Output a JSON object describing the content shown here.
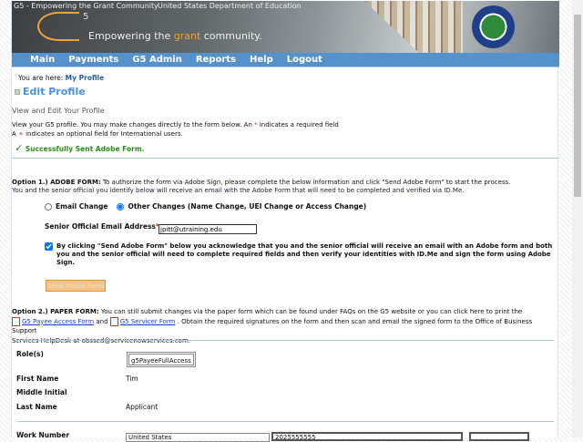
{
  "header": {
    "logo_alt": "G5 - Empowering the Grant Community",
    "dept_alt": "United States Department of Education",
    "logo_number": "5",
    "tagline_pre": "Empowering the ",
    "tagline_accent": "grant",
    "tagline_post": " community."
  },
  "nav": [
    {
      "label": "Main"
    },
    {
      "label": "Payments"
    },
    {
      "label": "G5 Admin"
    },
    {
      "label": "Reports"
    },
    {
      "label": "Help"
    },
    {
      "label": "Logout"
    }
  ],
  "breadcrumb": {
    "prefix": "You are here:",
    "current": "My Profile"
  },
  "page_title": "Edit Profile",
  "subtitle": "View and Edit Your Profile",
  "intro": {
    "line1_pre": "View your G5 profile. You may make changes directly to the form below. An ",
    "line1_mark": "*",
    "line1_post": " indicates a required field",
    "line2_pre": "A ",
    "line2_mark": "+",
    "line2_post": " indicates an optional field for International users."
  },
  "success_message": "Successfully Sent Adobe Form.",
  "option1": {
    "label": "Option 1.) ADOBE FORM:",
    "text": " To authorize the form via Adobe Sign, please complete the below information and click \"Send Adobe Form\" to start the process.",
    "text2": "You and the senior official you identify below will receive an email with the Adobe Form that will need to be completed and verified via ID.Me.",
    "radio_email": "Email Change",
    "radio_other": "Other Changes (Name Change, UEI Change or Access Change)",
    "selected": "Other Changes",
    "email_label": "Senior Official Email Address",
    "email_required": "*",
    "email_value": "jpitt@utraining.edu",
    "ack_checked": true,
    "ack_text": "By clicking \"Send Adobe Form\" below you acknowledge that you and the senior official will receive an email with an Adobe form and both you and the senior official will need to complete required fields and then verify your identities with ID.Me and sign the form using Adobe Sign.",
    "send_button": "Send Adobe Form"
  },
  "option2": {
    "label": "Option 2.) PAPER FORM:",
    "text": " You can still submit changes via the paper form which can be found under FAQs on the G5 website or you can click here to print the",
    "link1": "G5 Payee Access Form",
    "and": "and",
    "link2": "G5 Servicer Form",
    "text2": ". Obtain the required signatures on the form and then scan and email the signed form to the Office of Business Support",
    "text3": "Services HelpDesk at obssed@servicenowservices.com."
  },
  "profile": {
    "roles_label": "Role(s)",
    "roles_value": "g5PayeeFullAccess",
    "first_name_label": "First Name",
    "first_name": "Tim",
    "middle_label": "Middle Initial",
    "middle": "",
    "last_name_label": "Last Name",
    "last_name": "Applicant",
    "work_label": "Work Number",
    "work_country": "United States",
    "work_number": "2025555555"
  },
  "colors": {
    "nav": "#5592cc",
    "title": "#4a90d9",
    "success": "#2a8a1a",
    "accent": "#f0a030"
  }
}
